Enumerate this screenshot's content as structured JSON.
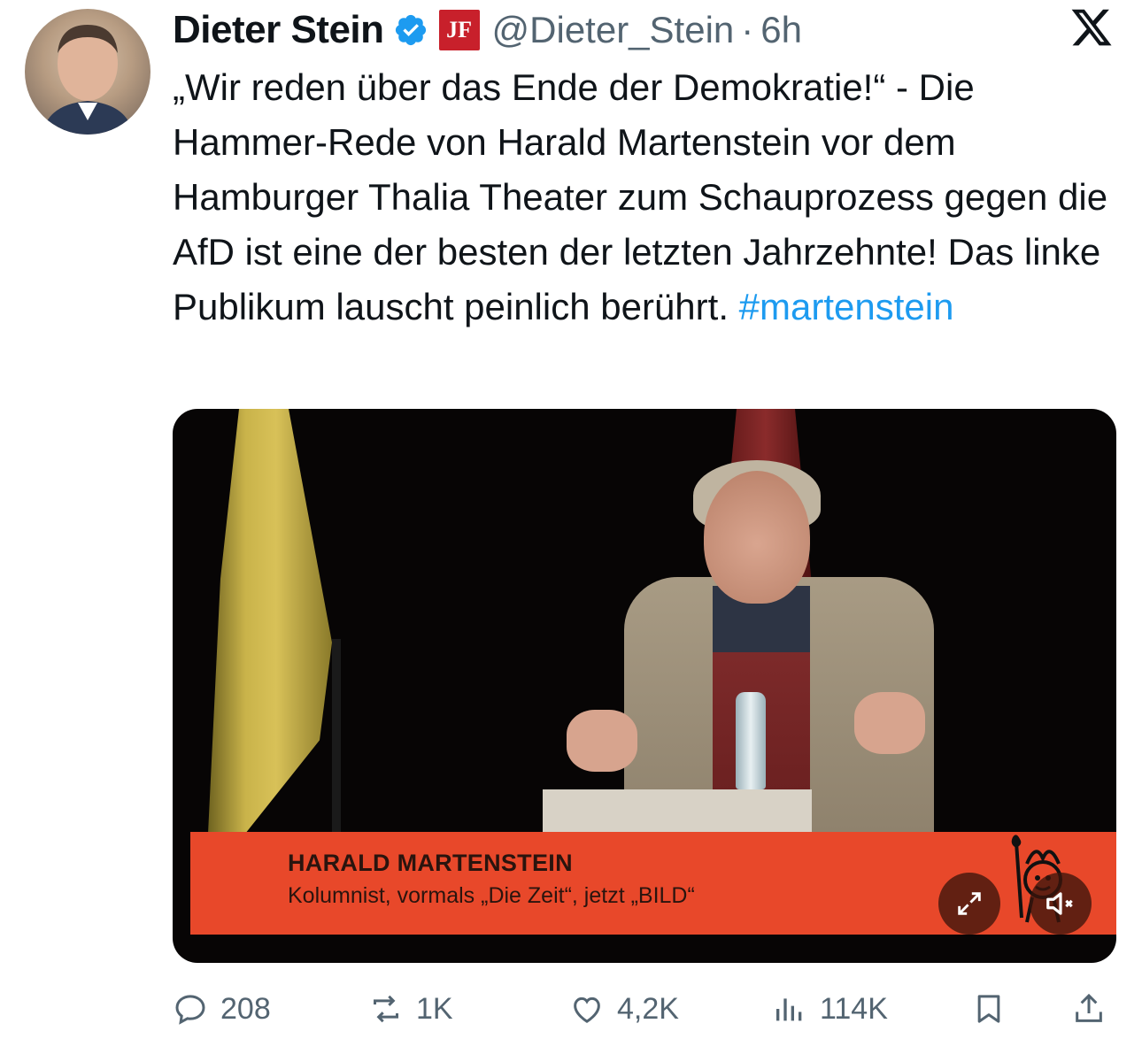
{
  "tweet": {
    "author_name": "Dieter Stein",
    "handle": "@Dieter_Stein",
    "separator": "·",
    "time": "6h",
    "badge_text": "JF",
    "text_main": "„Wir reden über das Ende der Demokratie!“ - Die Hammer-Rede von Harald Martenstein vor dem Hamburger Thalia Theater zum Schauprozess gegen die AfD ist eine der besten der letzten Jahrzehnte! Das linke Publikum lauscht peinlich berührt. ",
    "hashtag": "#martenstein"
  },
  "video": {
    "lower_third_name": "HARALD MARTENSTEIN",
    "lower_third_desc": "Kolumnist, vormals „Die Zeit“, jetzt „BILD“"
  },
  "actions": {
    "replies": "208",
    "reposts": "1K",
    "likes": "4,2K",
    "views": "114K"
  },
  "colors": {
    "accent": "#1d9bf0",
    "secondary_text": "#536471",
    "lower_third": "#e8482a",
    "badge": "#c8202b"
  }
}
